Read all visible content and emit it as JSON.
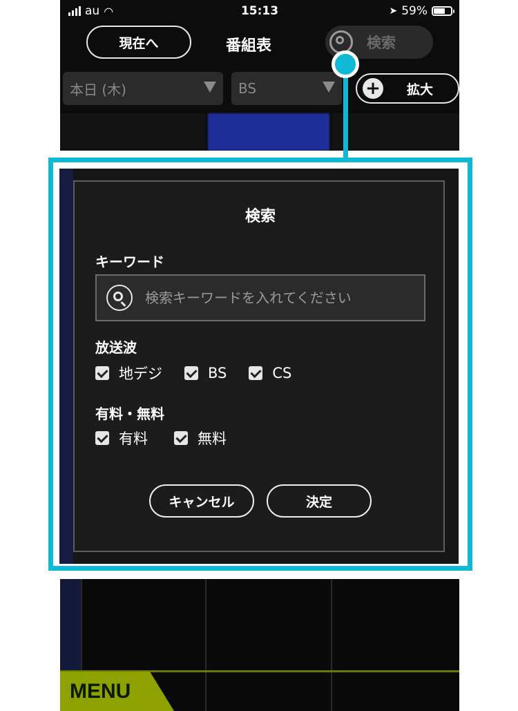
{
  "status_bar": {
    "carrier": "au",
    "time": "15:13",
    "battery": "59%"
  },
  "nav": {
    "now_button": "現在へ",
    "title": "番組表",
    "search_label": "検索"
  },
  "filters": {
    "day": "本日 (木)",
    "channel_type": "BS",
    "zoom_label": "拡大"
  },
  "dialog": {
    "title": "検索",
    "keyword_label": "キーワード",
    "keyword_placeholder": "検索キーワードを入れてください",
    "broadcast_label": "放送波",
    "broadcast_options": [
      "地デジ",
      "BS",
      "CS"
    ],
    "fee_label": "有料・無料",
    "fee_options": [
      "有料",
      "無料"
    ],
    "cancel_button": "キャンセル",
    "ok_button": "決定"
  },
  "menu_tab": "MENU",
  "colors": {
    "callout": "#10b9d3",
    "menu_tab": "#8da200",
    "channel_highlight": "#1e2f99"
  }
}
